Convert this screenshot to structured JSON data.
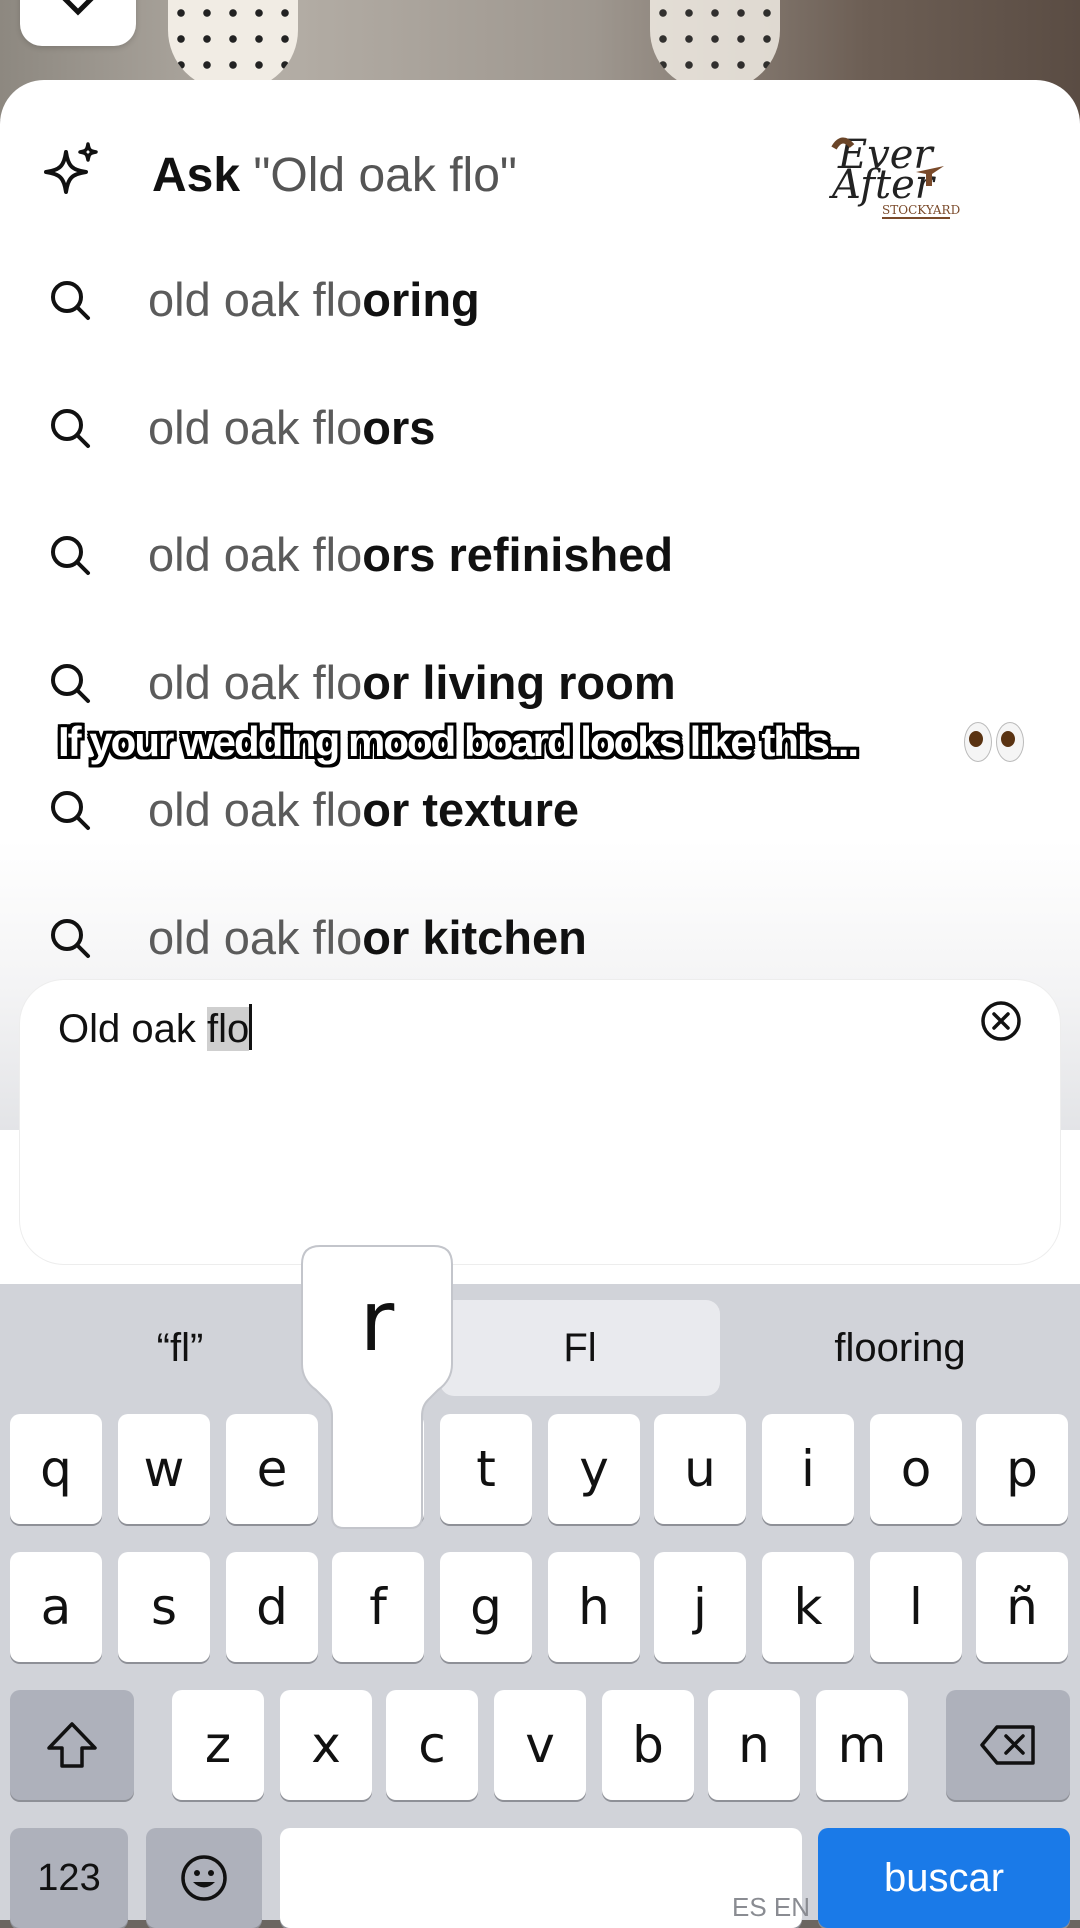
{
  "ask": {
    "prefix": "Ask ",
    "query": "\"Old oak flo\""
  },
  "logo": {
    "alt": "Ever After Farms Stockyard"
  },
  "suggestions": [
    {
      "typed": "old oak flo",
      "rest": "oring"
    },
    {
      "typed": "old oak flo",
      "rest": "ors"
    },
    {
      "typed": "old oak flo",
      "rest": "ors refinished"
    },
    {
      "typed": "old oak flo",
      "rest": "or living room"
    },
    {
      "typed": "old oak flo",
      "rest": "or texture"
    },
    {
      "typed": "old oak flo",
      "rest": "or kitchen"
    }
  ],
  "caption": "If your wedding mood board looks like this...",
  "input": {
    "prefix": "Old oak ",
    "marked": "flo"
  },
  "predictions": [
    "“fl”",
    "Fl",
    "flooring"
  ],
  "keyboard": {
    "row1": [
      "q",
      "w",
      "e",
      "r",
      "t",
      "y",
      "u",
      "i",
      "o",
      "p"
    ],
    "row2": [
      "a",
      "s",
      "d",
      "f",
      "g",
      "h",
      "j",
      "k",
      "l",
      "ñ"
    ],
    "row3": [
      "z",
      "x",
      "c",
      "v",
      "b",
      "n",
      "m"
    ],
    "numbers_label": "123",
    "search_label": "buscar",
    "lang_label": "ES EN",
    "pressed_key": "r"
  }
}
